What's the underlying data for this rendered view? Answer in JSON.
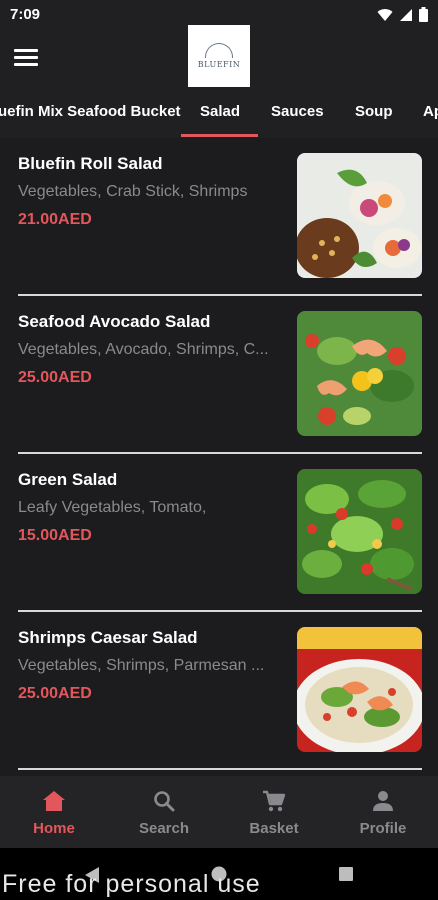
{
  "status": {
    "time": "7:09"
  },
  "header": {
    "logo_text": "BLUEFIN"
  },
  "tabs": [
    {
      "label": "uefin Mix Seafood Bucket"
    },
    {
      "label": "Salad",
      "active": true
    },
    {
      "label": "Sauces"
    },
    {
      "label": "Soup"
    },
    {
      "label": "Ap"
    }
  ],
  "items": [
    {
      "name": "Bluefin Roll Salad",
      "desc": "Vegetables, Crab Stick, Shrimps",
      "price": "21.00AED",
      "image": "spring-roll-salad"
    },
    {
      "name": "Seafood Avocado Salad",
      "desc": "Vegetables, Avocado, Shrimps, C...",
      "price": "25.00AED",
      "image": "avocado-shrimp-salad"
    },
    {
      "name": "Green Salad",
      "desc": "Leafy Vegetables, Tomato,",
      "price": "15.00AED",
      "image": "green-salad"
    },
    {
      "name": "Shrimps Caesar Salad",
      "desc": "Vegetables, Shrimps, Parmesan ...",
      "price": "25.00AED",
      "image": "caesar-salad"
    }
  ],
  "nav": [
    {
      "label": "Home",
      "icon": "home-icon",
      "active": true
    },
    {
      "label": "Search",
      "icon": "search-icon"
    },
    {
      "label": "Basket",
      "icon": "cart-icon"
    },
    {
      "label": "Profile",
      "icon": "profile-icon"
    }
  ],
  "watermark": "Free for personal use",
  "colors": {
    "accent": "#e2575b",
    "background": "#202023",
    "muted": "#8a8a8e"
  }
}
